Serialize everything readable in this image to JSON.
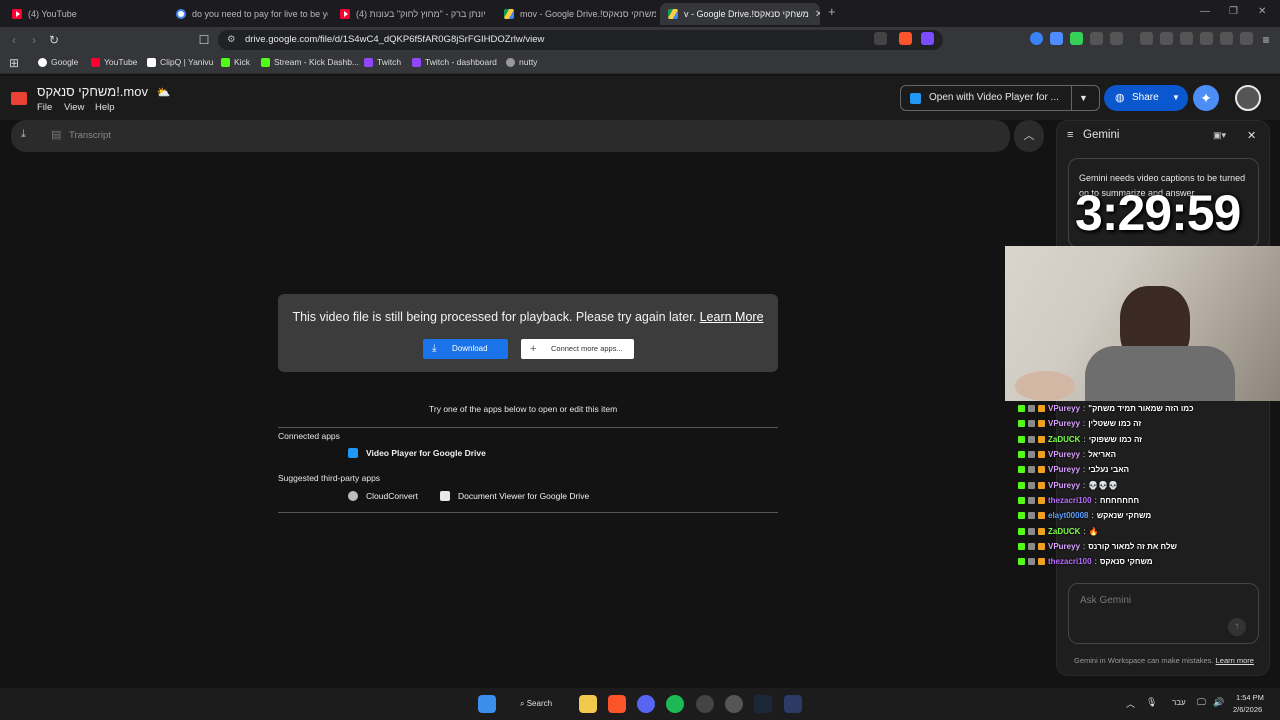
{
  "tabs": [
    {
      "label": "(4) YouTube"
    },
    {
      "label": "do you need to pay for live to be you"
    },
    {
      "label": "(4) יונתן ברק - \"מחוץ לחוק\" בעונות"
    },
    {
      "label": "mov - Google Drive.!משחקי סנאקס"
    },
    {
      "label": "v - Google Drive.!משחקי סנאקס"
    }
  ],
  "address": {
    "url": "drive.google.com/file/d/1S4wC4_dQKP6f5fAR0G8jSrFGIHDOZrlw/view"
  },
  "bookmarks": [
    {
      "label": "Google"
    },
    {
      "label": "YouTube"
    },
    {
      "label": "ClipQ | Yanivu"
    },
    {
      "label": "Kick"
    },
    {
      "label": "Stream - Kick Dashb..."
    },
    {
      "label": "Twitch"
    },
    {
      "label": "Twitch - dashboard"
    },
    {
      "label": "nutty"
    }
  ],
  "drive": {
    "file_title": "משחקי סנאקס!.mov",
    "menu": [
      "File",
      "View",
      "Help"
    ],
    "open_with": "Open with Video Player for ...",
    "share": "Share",
    "transcript": "Transcript"
  },
  "main": {
    "processing_msg": "This video file is still being processed for playback. Please try again later.",
    "learn_more": "Learn More",
    "download": "Download",
    "connect_more": "Connect more apps...",
    "try_apps": "Try one of the apps below to open or edit this item",
    "connected_heading": "Connected apps",
    "connected_app": "Video Player for Google Drive",
    "suggested_heading": "Suggested third-party apps",
    "suggested_apps": [
      "CloudConvert",
      "Document Viewer for Google Drive"
    ]
  },
  "gemini": {
    "title": "Gemini",
    "message": "Gemini needs video captions to be turned on to summarize and answer",
    "ask_placeholder": "Ask Gemini",
    "footer": "Gemini in Workspace can make mistakes.",
    "footer_link": "Learn more"
  },
  "overlay": {
    "timer": "3:29:59"
  },
  "chat": [
    {
      "user": "VPureyy",
      "color": "#d9a1ff",
      "msg": "\"כמו הזה שמאור תמיד משחק"
    },
    {
      "user": "VPureyy",
      "color": "#d9a1ff",
      "msg": "זה כמו ששטלין"
    },
    {
      "user": "ZaDUCK",
      "color": "#7cff4a",
      "msg": "זה כמו ששפוקי"
    },
    {
      "user": "VPureyy",
      "color": "#d9a1ff",
      "msg": "האריאל"
    },
    {
      "user": "VPureyy",
      "color": "#d9a1ff",
      "msg": "האבי נעלבי"
    },
    {
      "user": "VPureyy",
      "color": "#d9a1ff",
      "msg": "💀💀💀"
    },
    {
      "user": "thezacri100",
      "color": "#b86bff",
      "msg": "חחחחחחח"
    },
    {
      "user": "elayt00008",
      "color": "#5aa0ff",
      "msg": "משחקי שנאקש"
    },
    {
      "user": "ZaDUCK",
      "color": "#7cff4a",
      "msg": "🔥"
    },
    {
      "user": "VPureyy",
      "color": "#d9a1ff",
      "msg": "שלח את זה למאור קורנס"
    },
    {
      "user": "thezacri100",
      "color": "#b86bff",
      "msg": "משחקי סנאקס"
    }
  ],
  "taskbar": {
    "search": "Search",
    "lang": "עבר",
    "time": "1:54 PM",
    "date": "2/6/2026"
  }
}
